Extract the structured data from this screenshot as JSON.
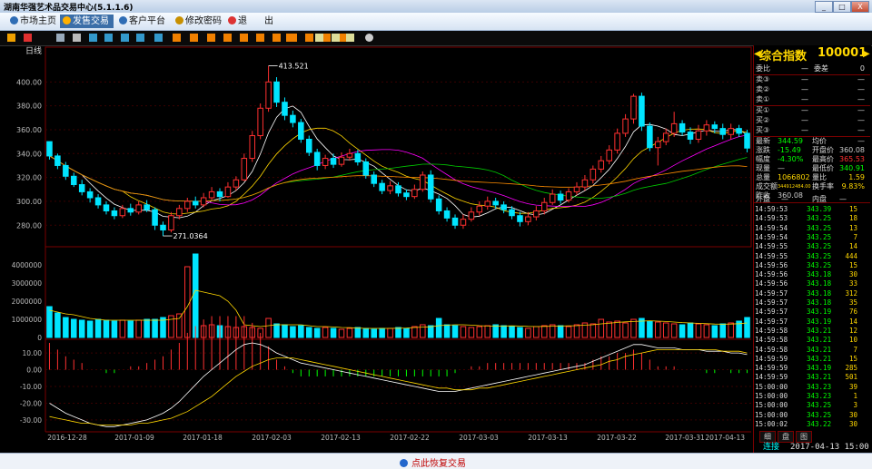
{
  "window": {
    "title": "湖南华强艺术品交易中心(5.1.1.6)",
    "minimize": "_",
    "maximize": "□",
    "close": "X"
  },
  "menu": [
    {
      "label": "市场主页",
      "icon": "globe-icon",
      "active": false
    },
    {
      "label": "发售交易",
      "icon": "yen-icon",
      "active": true
    },
    {
      "label": "客户平台",
      "icon": "globe-icon",
      "active": false
    },
    {
      "label": "修改密码",
      "icon": "key-icon",
      "active": false
    },
    {
      "label": "退",
      "icon": "power-icon",
      "active": false
    },
    {
      "label": "出",
      "icon": "",
      "active": false
    }
  ],
  "toolbar_icons": [
    "bar-chart-icon",
    "line-chart-icon",
    "table-icon",
    "list-icon",
    "grid-icon",
    "grid-icon",
    "grid-icon",
    "grid-icon",
    "close-box-icon",
    "number-icon",
    "number-icon",
    "number-icon",
    "number-icon",
    "number-icon",
    "number-icon",
    "number-icon",
    "number-icon",
    "number-icon",
    "number-icon",
    "number-icon",
    "flag-icon",
    "zoom-in-icon",
    "zoom-out-icon",
    "check-icon",
    "gear-icon"
  ],
  "chart": {
    "period_label": "日线",
    "high_label": "413.521",
    "low_label": "271.0364",
    "price_axis": [
      "400.00",
      "380.00",
      "360.00",
      "340.00",
      "320.00",
      "300.00",
      "280.00"
    ],
    "volume_axis": [
      "4000000",
      "3000000",
      "2000000",
      "1000000",
      "0"
    ],
    "macd_axis": [
      "10.00",
      "0.00",
      "-10.00",
      "-20.00",
      "-30.00"
    ],
    "date_axis": [
      "2016-12-28",
      "2017-01-09",
      "2017-01-18",
      "2017-02-03",
      "2017-02-13",
      "2017-02-22",
      "2017-03-03",
      "2017-03-13",
      "2017-03-22",
      "2017-03-31",
      "2017-04-13"
    ],
    "colors": {
      "up": "#ff3030",
      "down": "#00e5ff",
      "ma5": "#ffffff",
      "ma10": "#ffd700",
      "ma20": "#ff00ff",
      "ma30": "#00cc00",
      "ma60": "#ff8c00",
      "grid": "#7a0000"
    }
  },
  "chart_data": {
    "type": "candlestick",
    "ylim": [
      265,
      420
    ],
    "high": 413.521,
    "low": 271.0364,
    "candles": [
      [
        350.0,
        338.0,
        343.0,
        335.0
      ],
      [
        338.0,
        330.0,
        340.0,
        327.0
      ],
      [
        330.0,
        321.0,
        333.0,
        318.0
      ],
      [
        321.0,
        314.0,
        324.0,
        312.0
      ],
      [
        314.0,
        308.0,
        318.0,
        305.0
      ],
      [
        308.0,
        303.0,
        311.0,
        299.0
      ],
      [
        303.0,
        297.0,
        306.0,
        294.0
      ],
      [
        297.0,
        292.0,
        300.0,
        289.0
      ],
      [
        292.0,
        288.0,
        295.0,
        285.0
      ],
      [
        288.0,
        294.0,
        297.0,
        286.0
      ],
      [
        294.0,
        291.0,
        298.0,
        288.0
      ],
      [
        291.0,
        297.0,
        300.0,
        289.0
      ],
      [
        297.0,
        293.0,
        301.0,
        291.0
      ],
      [
        293.0,
        280.0,
        295.0,
        276.0
      ],
      [
        280.0,
        276.0,
        283.0,
        271.0
      ],
      [
        276.0,
        288.0,
        291.0,
        274.0
      ],
      [
        288.0,
        294.0,
        297.0,
        285.0
      ],
      [
        294.0,
        300.0,
        303.0,
        291.0
      ],
      [
        300.0,
        297.0,
        304.0,
        294.0
      ],
      [
        297.0,
        303.0,
        307.0,
        295.0
      ],
      [
        303.0,
        308.0,
        312.0,
        301.0
      ],
      [
        308.0,
        304.0,
        311.0,
        300.0
      ],
      [
        304.0,
        312.0,
        316.0,
        303.0
      ],
      [
        312.0,
        318.0,
        321.0,
        309.0
      ],
      [
        318.0,
        336.0,
        340.0,
        317.0
      ],
      [
        336.0,
        355.0,
        359.0,
        333.0
      ],
      [
        355.0,
        378.0,
        382.0,
        352.0
      ],
      [
        378.0,
        400.0,
        413.5,
        375.0
      ],
      [
        400.0,
        383.0,
        404.0,
        379.0
      ],
      [
        383.0,
        372.0,
        387.0,
        368.0
      ],
      [
        372.0,
        366.0,
        376.0,
        362.0
      ],
      [
        366.0,
        352.0,
        369.0,
        349.0
      ],
      [
        352.0,
        341.0,
        355.0,
        338.0
      ],
      [
        341.0,
        330.0,
        344.0,
        326.0
      ],
      [
        330.0,
        336.0,
        339.0,
        327.0
      ],
      [
        336.0,
        331.0,
        340.0,
        328.0
      ],
      [
        331.0,
        337.0,
        341.0,
        329.0
      ],
      [
        337.0,
        340.0,
        344.0,
        334.0
      ],
      [
        340.0,
        333.0,
        343.0,
        330.0
      ],
      [
        333.0,
        322.0,
        336.0,
        319.0
      ],
      [
        322.0,
        315.0,
        325.0,
        312.0
      ],
      [
        315.0,
        309.0,
        318.0,
        306.0
      ],
      [
        309.0,
        313.0,
        317.0,
        306.0
      ],
      [
        313.0,
        307.0,
        316.0,
        304.0
      ],
      [
        307.0,
        304.0,
        310.0,
        301.0
      ],
      [
        304.0,
        310.0,
        314.0,
        302.0
      ],
      [
        310.0,
        322.0,
        325.0,
        308.0
      ],
      [
        322.0,
        302.0,
        326.0,
        299.0
      ],
      [
        302.0,
        292.0,
        305.0,
        289.0
      ],
      [
        292.0,
        286.0,
        295.0,
        283.0
      ],
      [
        286.0,
        280.0,
        289.0,
        277.0
      ],
      [
        280.0,
        285.0,
        289.0,
        277.0
      ],
      [
        285.0,
        291.0,
        295.0,
        283.0
      ],
      [
        291.0,
        296.0,
        300.0,
        288.0
      ],
      [
        296.0,
        300.0,
        304.0,
        293.0
      ],
      [
        300.0,
        297.0,
        303.0,
        294.0
      ],
      [
        297.0,
        293.0,
        300.0,
        290.0
      ],
      [
        293.0,
        288.0,
        296.0,
        285.0
      ],
      [
        288.0,
        283.0,
        291.0,
        279.0
      ],
      [
        283.0,
        287.0,
        291.0,
        280.0
      ],
      [
        287.0,
        292.0,
        296.0,
        284.0
      ],
      [
        292.0,
        299.0,
        303.0,
        289.0
      ],
      [
        299.0,
        306.0,
        310.0,
        297.0
      ],
      [
        306.0,
        301.0,
        309.0,
        298.0
      ],
      [
        301.0,
        308.0,
        311.0,
        299.0
      ],
      [
        308.0,
        312.0,
        316.0,
        305.0
      ],
      [
        312.0,
        318.0,
        322.0,
        309.0
      ],
      [
        318.0,
        327.0,
        330.0,
        315.0
      ],
      [
        327.0,
        334.0,
        338.0,
        324.0
      ],
      [
        334.0,
        343.0,
        347.0,
        331.0
      ],
      [
        343.0,
        357.0,
        361.0,
        340.0
      ],
      [
        357.0,
        369.0,
        373.0,
        354.0
      ],
      [
        369.0,
        388.0,
        390.0,
        365.0
      ],
      [
        388.0,
        363.0,
        391.0,
        359.0
      ],
      [
        363.0,
        345.0,
        366.0,
        342.0
      ],
      [
        345.0,
        350.0,
        354.0,
        330.0
      ],
      [
        350.0,
        357.0,
        361.0,
        347.0
      ],
      [
        357.0,
        365.0,
        375.0,
        354.0
      ],
      [
        365.0,
        358.0,
        368.0,
        355.0
      ],
      [
        358.0,
        352.0,
        362.0,
        348.0
      ],
      [
        352.0,
        359.0,
        364.0,
        349.0
      ],
      [
        359.0,
        364.0,
        368.0,
        355.0
      ],
      [
        364.0,
        361.0,
        367.0,
        357.0
      ],
      [
        361.0,
        356.0,
        365.0,
        352.0
      ],
      [
        356.0,
        361.0,
        365.0,
        352.0
      ],
      [
        361.0,
        357.0,
        364.0,
        354.0
      ],
      [
        357.0,
        344.6,
        360.0,
        341.0
      ]
    ],
    "volume": [
      1700000,
      1350000,
      1100000,
      1000000,
      950000,
      900000,
      1000000,
      950000,
      900000,
      950000,
      900000,
      950000,
      1000000,
      1000000,
      1100000,
      1200000,
      1300000,
      3900000,
      4600000,
      650000,
      700000,
      650000,
      600000,
      550000,
      600000,
      550000,
      500000,
      1050000,
      750000,
      700000,
      600000,
      650000,
      550000,
      500000,
      550000,
      500000,
      450000,
      500000,
      550000,
      500000,
      450000,
      500000,
      500000,
      550000,
      500000,
      600000,
      700000,
      650000,
      1050000,
      700000,
      650000,
      600000,
      550000,
      600000,
      650000,
      700000,
      650000,
      600000,
      550000,
      500000,
      600000,
      650000,
      700000,
      650000,
      600000,
      700000,
      800000,
      750000,
      1000000,
      850000,
      900000,
      800000,
      1000000,
      1050000,
      900000,
      850000,
      800000,
      750000,
      700000,
      800000,
      750000,
      700000,
      650000,
      750000,
      800000,
      900000,
      1100000
    ],
    "ma_volume": [
      1500000,
      1400000,
      1300000,
      1250000,
      1150000,
      1050000,
      1000000,
      950000,
      950000,
      950000,
      950000,
      950000,
      950000,
      950000,
      950000,
      1000000,
      1050000,
      1700000,
      2600000,
      2500000,
      2400000,
      2300000,
      2000000,
      1500000,
      700000,
      650000,
      600000,
      650000,
      700000,
      700000,
      700000,
      700000,
      650000,
      600000,
      600000,
      580000,
      550000,
      540000,
      520000,
      500000,
      500000,
      500000,
      500000,
      510000,
      520000,
      550000,
      570000,
      590000,
      650000,
      680000,
      700000,
      700000,
      680000,
      650000,
      630000,
      620000,
      630000,
      640000,
      630000,
      610000,
      600000,
      610000,
      620000,
      630000,
      640000,
      650000,
      680000,
      700000,
      750000,
      780000,
      830000,
      860000,
      880000,
      900000,
      920000,
      900000,
      880000,
      850000,
      820000,
      800000,
      780000,
      760000,
      740000,
      730000,
      740000,
      760000,
      800000
    ],
    "macd_dif": [
      -20,
      -23,
      -26,
      -28,
      -30,
      -32,
      -33,
      -34,
      -34,
      -33,
      -32,
      -31,
      -30,
      -28,
      -26,
      -23,
      -19,
      -14,
      -9,
      -4,
      0,
      4,
      8,
      12,
      15,
      16,
      15,
      13,
      10,
      8,
      6,
      4,
      3,
      2,
      1,
      0,
      -1,
      -2,
      -3,
      -4,
      -5,
      -6,
      -7,
      -8,
      -9,
      -10,
      -11,
      -12,
      -13,
      -13,
      -13,
      -12,
      -11,
      -10,
      -9,
      -8,
      -7,
      -6,
      -5,
      -4,
      -3,
      -2,
      -1,
      0,
      1,
      2,
      3,
      5,
      7,
      9,
      11,
      13,
      15,
      15,
      14,
      13,
      13,
      13,
      12,
      12,
      12,
      11,
      11,
      11,
      10,
      10,
      9
    ],
    "macd_dea": [
      -28,
      -29,
      -30,
      -31,
      -32,
      -32,
      -33,
      -33,
      -33,
      -33,
      -33,
      -32,
      -32,
      -31,
      -30,
      -29,
      -27,
      -25,
      -22,
      -19,
      -16,
      -12,
      -8,
      -4,
      -1,
      2,
      4,
      6,
      7,
      7,
      7,
      6,
      5,
      4,
      3,
      2,
      1,
      0,
      -1,
      -2,
      -3,
      -4,
      -5,
      -6,
      -7,
      -8,
      -9,
      -10,
      -11,
      -11,
      -12,
      -12,
      -12,
      -11,
      -11,
      -10,
      -9,
      -8,
      -7,
      -6,
      -5,
      -4,
      -3,
      -2,
      -1,
      0,
      1,
      2,
      3,
      5,
      6,
      8,
      9,
      10,
      11,
      12,
      12,
      12,
      12,
      12,
      12,
      12,
      12,
      11,
      11,
      11,
      10
    ]
  },
  "quote": {
    "name": "综合指数",
    "code": "100001",
    "weibi_label": "委比",
    "weibi_value": "—",
    "weicha_label": "委差",
    "weicha_value": "0",
    "asks": [
      {
        "label": "卖③",
        "price": "—",
        "vol": "—"
      },
      {
        "label": "卖②",
        "price": "—",
        "vol": "—"
      },
      {
        "label": "卖①",
        "price": "—",
        "vol": "—"
      }
    ],
    "bids": [
      {
        "label": "买①",
        "price": "—",
        "vol": "—"
      },
      {
        "label": "买②",
        "price": "—",
        "vol": "—"
      },
      {
        "label": "买③",
        "price": "—",
        "vol": "—"
      }
    ],
    "stats": [
      {
        "l1": "最新",
        "v1": "344.59",
        "c1": "#00ff00",
        "l2": "均价",
        "v2": "—",
        "c2": "#cccccc"
      },
      {
        "l1": "涨跌",
        "v1": "-15.49",
        "c1": "#00ff00",
        "l2": "开盘价",
        "v2": "360.08",
        "c2": "#cccccc"
      },
      {
        "l1": "幅度",
        "v1": "-4.30%",
        "c1": "#00ff00",
        "l2": "最高价",
        "v2": "365.53",
        "c2": "#ff3030"
      },
      {
        "l1": "现量",
        "v1": "—",
        "c1": "#cccccc",
        "l2": "最低价",
        "v2": "340.91",
        "c2": "#00ff00"
      },
      {
        "l1": "总量",
        "v1": "1066802",
        "c1": "#ffd700",
        "l2": "量比",
        "v2": "1.59",
        "c2": "#ffd700"
      },
      {
        "l1": "成交额",
        "v1": "344912484.00",
        "c1": "#ffd700",
        "l2": "换手率",
        "v2": "9.83%",
        "c2": "#ffd700"
      },
      {
        "l1": "昨收",
        "v1": "360.08",
        "c1": "#cccccc",
        "l2": "",
        "v2": "",
        "c2": "#cccccc"
      }
    ],
    "outer_label": "外盘",
    "outer_value": "—",
    "inner_label": "内盘",
    "inner_value": "—"
  },
  "ticks": [
    [
      "14:59:53",
      "343.39",
      "15"
    ],
    [
      "14:59:53",
      "343.25",
      "18"
    ],
    [
      "14:59:54",
      "343.25",
      "13"
    ],
    [
      "14:59:54",
      "343.25",
      "7"
    ],
    [
      "14:59:55",
      "343.25",
      "14"
    ],
    [
      "14:59:55",
      "343.25",
      "444"
    ],
    [
      "14:59:56",
      "343.25",
      "15"
    ],
    [
      "14:59:56",
      "343.18",
      "30"
    ],
    [
      "14:59:56",
      "343.18",
      "33"
    ],
    [
      "14:59:57",
      "343.18",
      "312"
    ],
    [
      "14:59:57",
      "343.18",
      "35"
    ],
    [
      "14:59:57",
      "343.19",
      "76"
    ],
    [
      "14:59:57",
      "343.19",
      "14"
    ],
    [
      "14:59:58",
      "343.21",
      "12"
    ],
    [
      "14:59:58",
      "343.21",
      "10"
    ],
    [
      "14:59:58",
      "343.21",
      "7"
    ],
    [
      "14:59:59",
      "343.21",
      "15"
    ],
    [
      "14:59:59",
      "343.19",
      "285"
    ],
    [
      "14:59:59",
      "343.21",
      "501"
    ],
    [
      "15:00:00",
      "343.23",
      "39"
    ],
    [
      "15:00:00",
      "343.23",
      "1"
    ],
    [
      "15:00:00",
      "343.25",
      "3"
    ],
    [
      "15:00:00",
      "343.25",
      "30"
    ],
    [
      "15:00:02",
      "343.22",
      "30"
    ]
  ],
  "right_tabs": [
    "细",
    "盘",
    "图"
  ],
  "status": {
    "connection": "连接",
    "datetime": "2017-04-13 15:00"
  },
  "footer": {
    "button": "点此恢复交易"
  }
}
